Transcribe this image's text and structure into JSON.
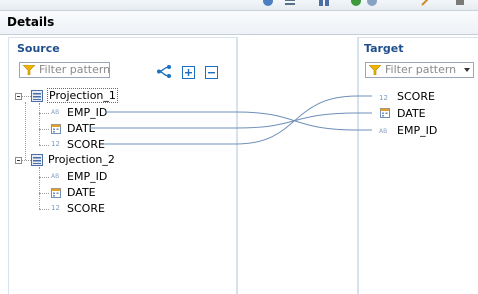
{
  "details": {
    "title": "Details"
  },
  "source": {
    "title": "Source",
    "filter_placeholder": "Filter pattern",
    "tools": [
      "auto-map-icon",
      "expand-all-icon",
      "collapse-all-icon"
    ],
    "projections": [
      {
        "label": "Projection_1",
        "fields": [
          {
            "name": "EMP_ID",
            "type": "AB"
          },
          {
            "name": "DATE",
            "type": "date"
          },
          {
            "name": "SCORE",
            "type": "12"
          }
        ]
      },
      {
        "label": "Projection_2",
        "fields": [
          {
            "name": "EMP_ID",
            "type": "AB"
          },
          {
            "name": "DATE",
            "type": "date"
          },
          {
            "name": "SCORE",
            "type": "12"
          }
        ]
      }
    ]
  },
  "target": {
    "title": "Target",
    "filter_placeholder": "Filter pattern",
    "fields": [
      {
        "name": "SCORE",
        "type": "12"
      },
      {
        "name": "DATE",
        "type": "date"
      },
      {
        "name": "EMP_ID",
        "type": "AB"
      }
    ]
  },
  "mappings": [
    {
      "from": "EMP_ID",
      "to": "EMP_ID"
    },
    {
      "from": "DATE",
      "to": "DATE"
    },
    {
      "from": "SCORE",
      "to": "SCORE"
    }
  ],
  "colors": {
    "link": "#6f8fb8",
    "panel_border": "#d6e2ef",
    "title": "#1f4e8c"
  }
}
